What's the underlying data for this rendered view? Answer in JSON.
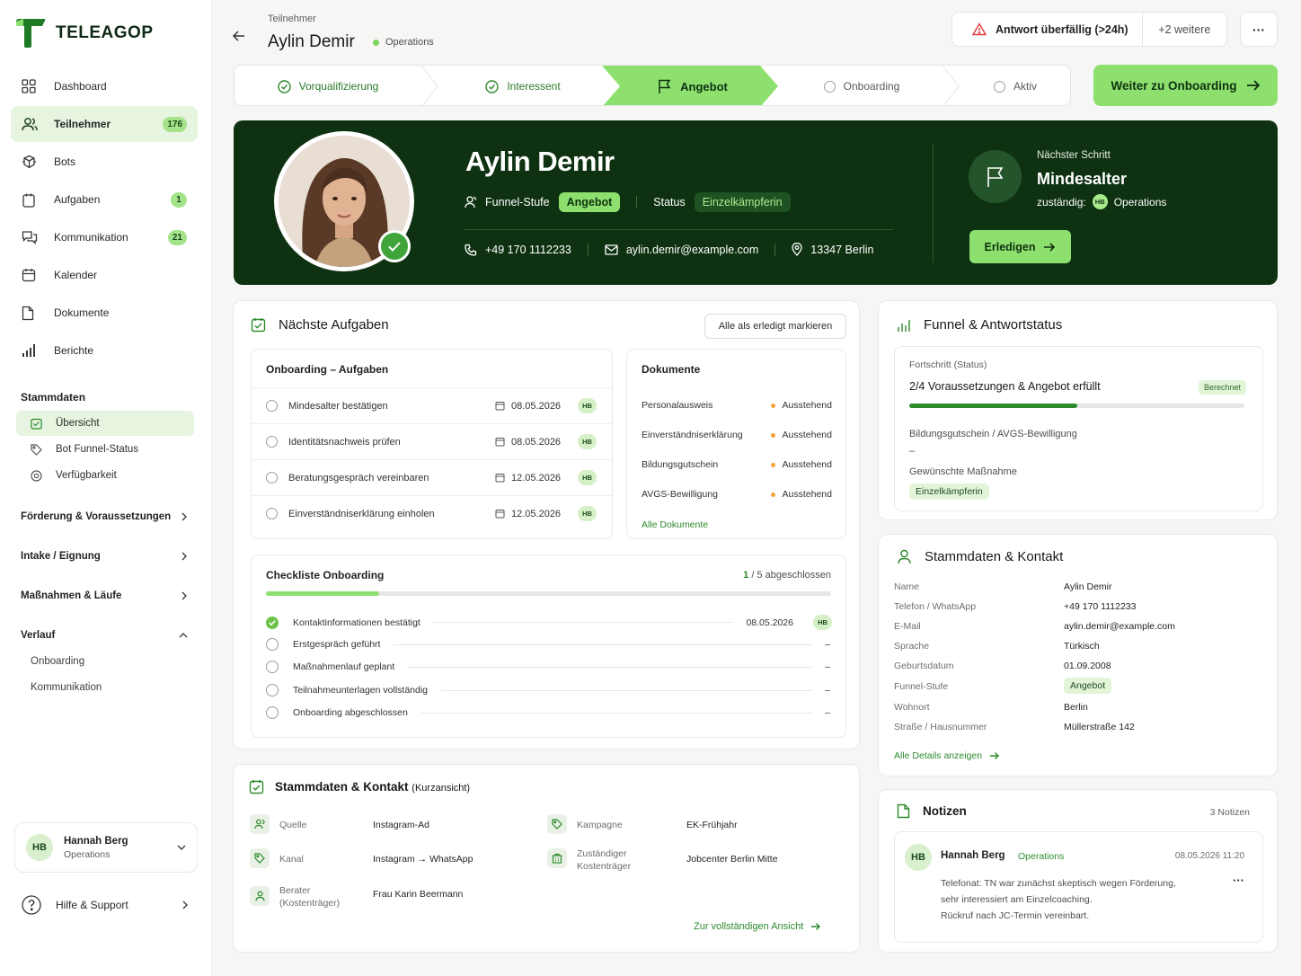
{
  "app": {
    "name": "TELEAGOP"
  },
  "sidebar": {
    "nav": [
      {
        "label": "Dashboard",
        "icon": "grid-icon",
        "badge": null
      },
      {
        "label": "Teilnehmer",
        "icon": "users-icon",
        "badge": "176",
        "active": true
      },
      {
        "label": "Bots",
        "icon": "bot-icon",
        "badge": null
      },
      {
        "label": "Aufgaben",
        "icon": "clipboard-icon",
        "badge": "1"
      },
      {
        "label": "Kommunikation",
        "icon": "chat-icon",
        "badge": "21"
      },
      {
        "label": "Kalender",
        "icon": "calendar-icon",
        "badge": null
      },
      {
        "label": "Dokumente",
        "icon": "document-icon",
        "badge": null
      },
      {
        "label": "Berichte",
        "icon": "bar-chart-icon",
        "badge": null
      }
    ],
    "stammdaten_title": "Stammdaten",
    "stammdaten_items": [
      {
        "label": "Übersicht",
        "icon": "overview-icon",
        "active": true
      },
      {
        "label": "Bot Funnel-Status",
        "icon": "tag-icon"
      },
      {
        "label": "Verfügbarkeit",
        "icon": "target-icon"
      }
    ],
    "groups": [
      {
        "label": "Förderung & Voraussetzungen"
      },
      {
        "label": "Intake / Eignung"
      },
      {
        "label": "Maßnahmen & Läufe"
      }
    ],
    "verlauf": {
      "label": "Verlauf",
      "items": [
        "Onboarding",
        "Kommunikation"
      ]
    },
    "user": {
      "initials": "HB",
      "name": "Hannah Berg",
      "role": "Operations"
    },
    "help": "Hilfe & Support"
  },
  "header": {
    "breadcrumb": "Teilnehmer",
    "name": "Aylin Demir",
    "tag": "Operations",
    "alert": "Antwort überfällig (>24h)",
    "alert_more": "+2 weitere",
    "more": "···"
  },
  "stepper": {
    "steps": [
      {
        "label": "Vorqualifizierung",
        "state": "done"
      },
      {
        "label": "Interessent",
        "state": "done"
      },
      {
        "label": "Angebot",
        "state": "current"
      },
      {
        "label": "Onboarding",
        "state": "pending"
      },
      {
        "label": "Aktiv",
        "state": "pending"
      }
    ],
    "cta": "Weiter zu Onboarding"
  },
  "hero": {
    "name": "Aylin Demir",
    "funnel_label": "Funnel-Stufe",
    "funnel_value": "Angebot",
    "status_label": "Status",
    "status_value": "Einzelkämpferin",
    "phone": "+49 170 1112233",
    "email": "aylin.demir@example.com",
    "location": "13347 Berlin",
    "next_label": "Nächster Schritt",
    "next_value": "Mindesalter",
    "resp_label": "zuständig:",
    "resp_initials": "HB",
    "resp_value": "Operations",
    "done_button": "Erledigen"
  },
  "tasks": {
    "title": "Nächste Aufgaben",
    "mark_all": "Alle als erledigt markieren",
    "onboarding_title": "Onboarding – Aufgaben",
    "items": [
      {
        "label": "Mindesalter bestätigen",
        "date": "08.05.2026",
        "owner": "HB"
      },
      {
        "label": "Identitätsnachweis prüfen",
        "date": "08.05.2026",
        "owner": "HB"
      },
      {
        "label": "Beratungsgespräch vereinbaren",
        "date": "12.05.2026",
        "owner": "HB"
      },
      {
        "label": "Einverständniserklärung einholen",
        "date": "12.05.2026",
        "owner": "HB"
      }
    ],
    "documents_title": "Dokumente",
    "documents": [
      {
        "label": "Personalausweis",
        "status": "Ausstehend"
      },
      {
        "label": "Einverständniserklärung",
        "status": "Ausstehend"
      },
      {
        "label": "Bildungsgutschein",
        "status": "Ausstehend"
      },
      {
        "label": "AVGS-Bewilligung",
        "status": "Ausstehend"
      }
    ],
    "all_documents": "Alle Dokumente"
  },
  "checklist": {
    "title": "Checkliste Onboarding",
    "progress_count": "1",
    "progress_rest": " / 5 abgeschlossen",
    "progress_fraction": 0.2,
    "items": [
      {
        "label": "Kontaktinformationen bestätigt",
        "done": true,
        "date": "08.05.2026",
        "owner": "HB"
      },
      {
        "label": "Erstgespräch geführt",
        "done": false,
        "date": "–"
      },
      {
        "label": "Maßnahmenlauf geplant",
        "done": false,
        "date": "–"
      },
      {
        "label": "Teilnahmeunterlagen vollständig",
        "done": false,
        "date": "–"
      },
      {
        "label": "Onboarding abgeschlossen",
        "done": false,
        "date": "–"
      }
    ]
  },
  "short": {
    "title": "Stammdaten & Kontakt",
    "title_suffix": "(Kurzansicht)",
    "left": [
      {
        "label": "Quelle",
        "value": "Instagram-Ad",
        "icon": "users-icon"
      },
      {
        "label": "Kanal",
        "value": "Instagram → WhatsApp",
        "icon": "tag-icon"
      },
      {
        "label": "Berater\n(Kostenträger)",
        "value": "Frau Karin Beermann",
        "icon": "person-icon"
      }
    ],
    "right": [
      {
        "label": "Kampagne",
        "value": "EK-Frühjahr",
        "icon": "tag-icon"
      },
      {
        "label": "Zuständiger\nKostenträger",
        "value": "Jobcenter Berlin Mitte",
        "icon": "building-icon"
      }
    ],
    "full_link": "Zur vollständigen Ansicht"
  },
  "funnel": {
    "title": "Funnel & Antwortstatus",
    "progress_label": "Fortschritt (Status)",
    "progress_value": "2/4 Voraussetzungen & Angebot erfüllt",
    "computed": "Berechnet",
    "progress_fraction": 0.5,
    "voucher_label": "Bildungsgutschein / AVGS-Bewilligung",
    "voucher_value": "–",
    "measure_label": "Gewünschte Maßnahme",
    "measure_value": "Einzelkämpferin"
  },
  "contact": {
    "title": "Stammdaten & Kontakt",
    "rows": [
      {
        "label": "Name",
        "value": "Aylin Demir"
      },
      {
        "label": "Telefon / WhatsApp",
        "value": "+49 170 1112233"
      },
      {
        "label": "E-Mail",
        "value": "aylin.demir@example.com"
      },
      {
        "label": "Sprache",
        "value": "Türkisch"
      },
      {
        "label": "Geburtsdatum",
        "value": "01.09.2008"
      },
      {
        "label": "Funnel-Stufe",
        "value": "Angebot",
        "tag": true
      },
      {
        "label": "Wohnort",
        "value": "Berlin"
      },
      {
        "label": "Straße / Hausnummer",
        "value": "Müllerstraße 142"
      }
    ],
    "details_link": "Alle Details anzeigen"
  },
  "notes": {
    "title": "Notizen",
    "count": "3 Notizen",
    "note": {
      "initials": "HB",
      "author": "Hannah Berg",
      "team": "Operations",
      "timestamp": "08.05.2026 11:20",
      "lines": [
        "Telefonat: TN war zunächst skeptisch wegen Förderung,",
        "sehr interessiert am Einzelcoaching.",
        "Rückruf nach JC-Termin vereinbart."
      ],
      "more": "···"
    }
  },
  "colors": {
    "brand_dark": "#0e3211",
    "accent": "#8ee06e",
    "link": "#2d8a2d",
    "warning": "#d93b3b",
    "pending": "#f2a23c"
  }
}
